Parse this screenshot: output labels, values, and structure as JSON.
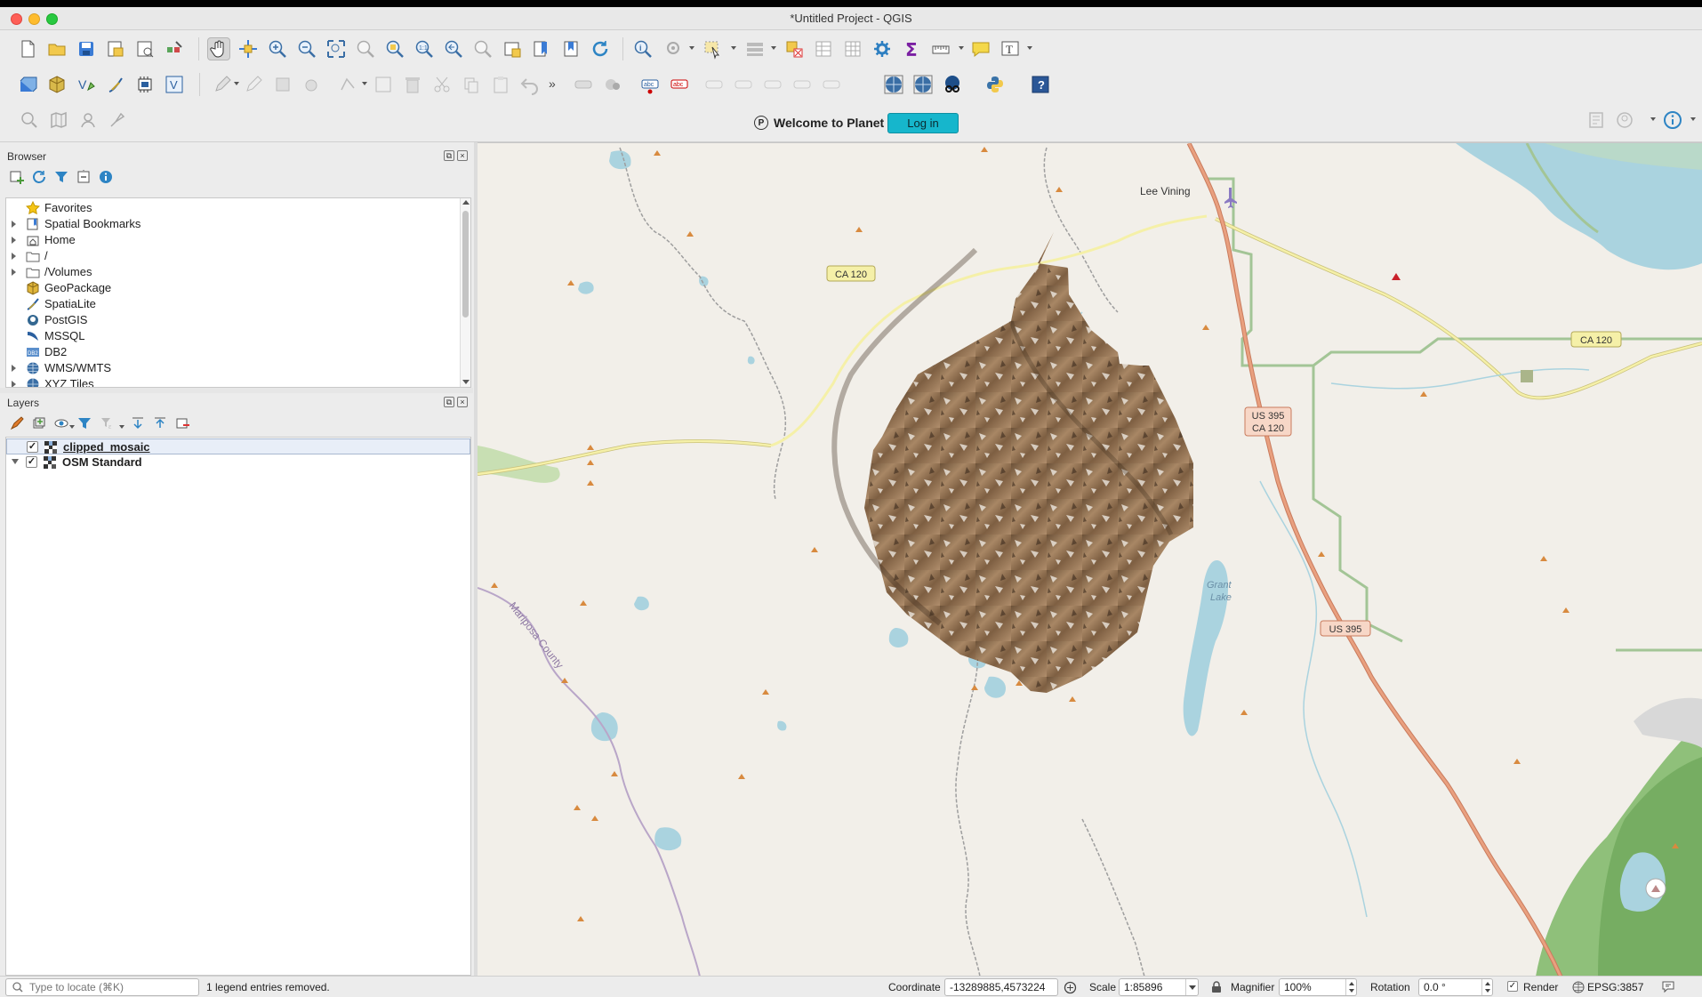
{
  "window": {
    "title": "*Untitled Project - QGIS"
  },
  "planet": {
    "welcome": "Welcome to Planet",
    "login": "Log in",
    "logo_letter": "P"
  },
  "browser": {
    "title": "Browser",
    "items": [
      {
        "label": "Favorites",
        "icon": "star-icon",
        "expandable": false
      },
      {
        "label": "Spatial Bookmarks",
        "icon": "bookmark-icon",
        "expandable": true
      },
      {
        "label": "Home",
        "icon": "home-folder-icon",
        "expandable": true
      },
      {
        "label": "/",
        "icon": "folder-icon",
        "expandable": true
      },
      {
        "label": "/Volumes",
        "icon": "folder-icon",
        "expandable": true
      },
      {
        "label": "GeoPackage",
        "icon": "geopackage-icon",
        "expandable": false
      },
      {
        "label": "SpatiaLite",
        "icon": "spatialite-icon",
        "expandable": false
      },
      {
        "label": "PostGIS",
        "icon": "postgis-icon",
        "expandable": false
      },
      {
        "label": "MSSQL",
        "icon": "mssql-icon",
        "expandable": false
      },
      {
        "label": "DB2",
        "icon": "db2-icon",
        "expandable": false
      },
      {
        "label": "WMS/WMTS",
        "icon": "globe-icon",
        "expandable": true
      },
      {
        "label": "XYZ Tiles",
        "icon": "globe-icon",
        "expandable": true
      }
    ]
  },
  "layers": {
    "title": "Layers",
    "items": [
      {
        "label": "clipped_mosaic",
        "checked": true,
        "selected": true
      },
      {
        "label": "OSM Standard",
        "checked": true,
        "selected": false
      }
    ]
  },
  "map": {
    "labels": {
      "lee_vining": "Lee Vining",
      "ca120_a": "CA 120",
      "ca120_b": "CA 120",
      "us395_a": "US 395",
      "us395_b": "CA 120",
      "us395_c": "US 395",
      "mariposa": "Mariposa County",
      "grant": "Grant",
      "lake": "Lake"
    },
    "colors": {
      "land": "#f2efe9",
      "water": "#aad3df",
      "forest": "#c8dfb3",
      "road_major": "#e9a07f",
      "road_secondary": "#f5f0a8",
      "boundary": "#9e9e9e",
      "county": "#b9a6c8",
      "imagery": "#8a6a4a"
    }
  },
  "status": {
    "locator_placeholder": "Type to locate (⌘K)",
    "message": "1 legend entries removed.",
    "coordinate_label": "Coordinate",
    "coordinate_value": "-13289885,4573224",
    "scale_label": "Scale",
    "scale_value": "1:85896",
    "magnifier_label": "Magnifier",
    "magnifier_value": "100%",
    "rotation_label": "Rotation",
    "rotation_value": "0.0 °",
    "render_label": "Render",
    "render_checked": true,
    "crs": "EPSG:3857"
  }
}
